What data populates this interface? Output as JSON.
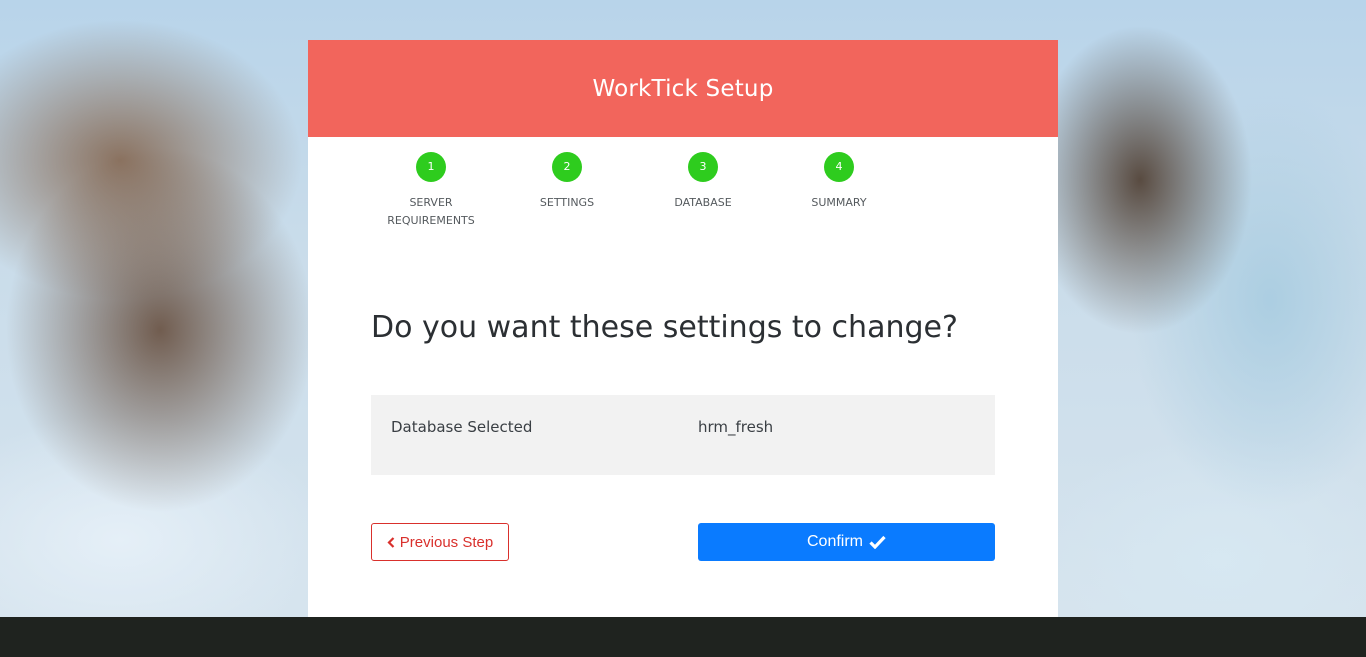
{
  "header": {
    "title": "WorkTick Setup"
  },
  "steps": [
    {
      "number": "1",
      "label": "SERVER REQUIREMENTS"
    },
    {
      "number": "2",
      "label": "SETTINGS"
    },
    {
      "number": "3",
      "label": "DATABASE"
    },
    {
      "number": "4",
      "label": "SUMMARY"
    }
  ],
  "main": {
    "question": "Do you want these settings to change?",
    "setting": {
      "name": "Database Selected",
      "value": "hrm_fresh"
    }
  },
  "buttons": {
    "previous_label": "Previous Step",
    "previous_icon": "chevron-left-icon",
    "confirm_label": "Confirm",
    "confirm_icon": "check-icon"
  },
  "colors": {
    "header": "#f2655c",
    "step_complete": "#2ecc1e",
    "primary": "#0a7bff",
    "danger": "#d9302c"
  }
}
